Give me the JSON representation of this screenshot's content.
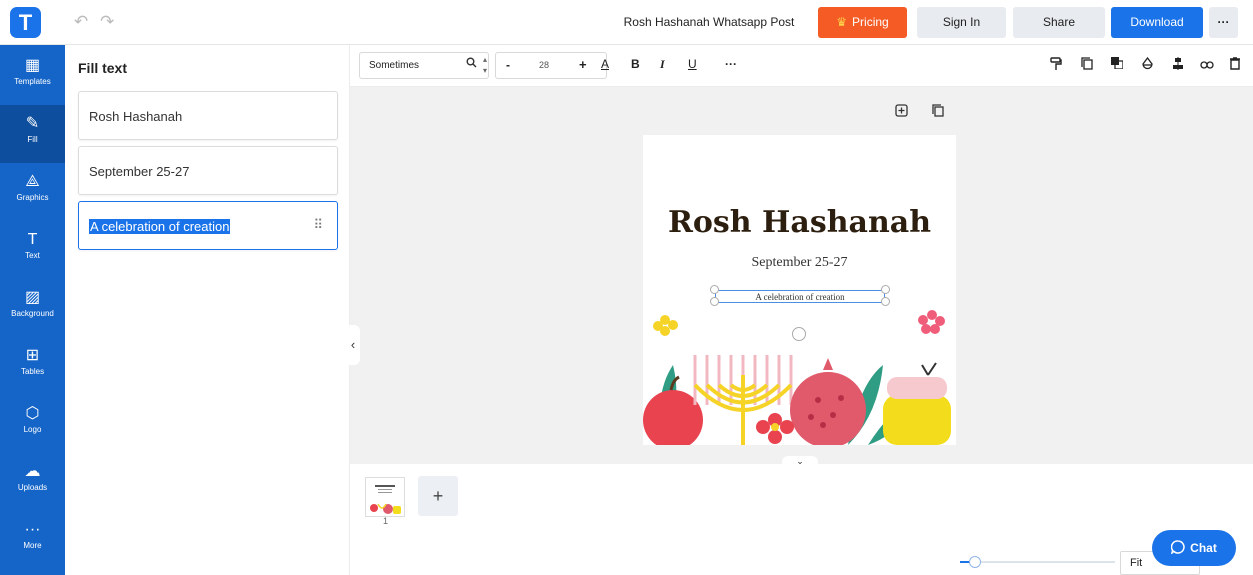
{
  "header": {
    "logo": "T",
    "undo_icon": "↶",
    "redo_icon": "↷",
    "doc_title": "Rosh Hashanah Whatsapp Post",
    "pricing": "Pricing",
    "signin": "Sign In",
    "share": "Share",
    "download": "Download",
    "more": "···"
  },
  "sidebar": {
    "items": [
      {
        "label": "Templates",
        "icon": "▦"
      },
      {
        "label": "Fill",
        "icon": "✎"
      },
      {
        "label": "Graphics",
        "icon": "⟁"
      },
      {
        "label": "Text",
        "icon": "T"
      },
      {
        "label": "Background",
        "icon": "▨"
      },
      {
        "label": "Tables",
        "icon": "⊞"
      },
      {
        "label": "Logo",
        "icon": "⬡"
      },
      {
        "label": "Uploads",
        "icon": "☁"
      },
      {
        "label": "More",
        "icon": "···"
      }
    ]
  },
  "panel": {
    "title": "Fill text",
    "fields": [
      {
        "value": "Rosh Hashanah"
      },
      {
        "value": "September 25-27"
      },
      {
        "value": "A celebration of creation"
      }
    ],
    "grip_icon": "⠿"
  },
  "toolbar": {
    "font": "Sometimes",
    "font_search_icon": "🔍",
    "font_stepper": "⌃⌄",
    "minus": "-",
    "size": "28",
    "plus": "+",
    "color_icon": "A",
    "bold": "B",
    "italic": "I",
    "underline": "U",
    "more": "···"
  },
  "artboard": {
    "title": "Rosh Hashanah",
    "date": "September 25-27",
    "tagline": "A celebration of creation"
  },
  "pages": {
    "add": "+",
    "page_number": "1"
  },
  "zoom": {
    "fit_label": "Fit",
    "level": 0.06
  },
  "chat": {
    "label": "Chat"
  },
  "colors": {
    "brand_blue": "#1a73e8",
    "sidebar_blue": "#1565c8",
    "pricing_orange": "#f45b25"
  }
}
